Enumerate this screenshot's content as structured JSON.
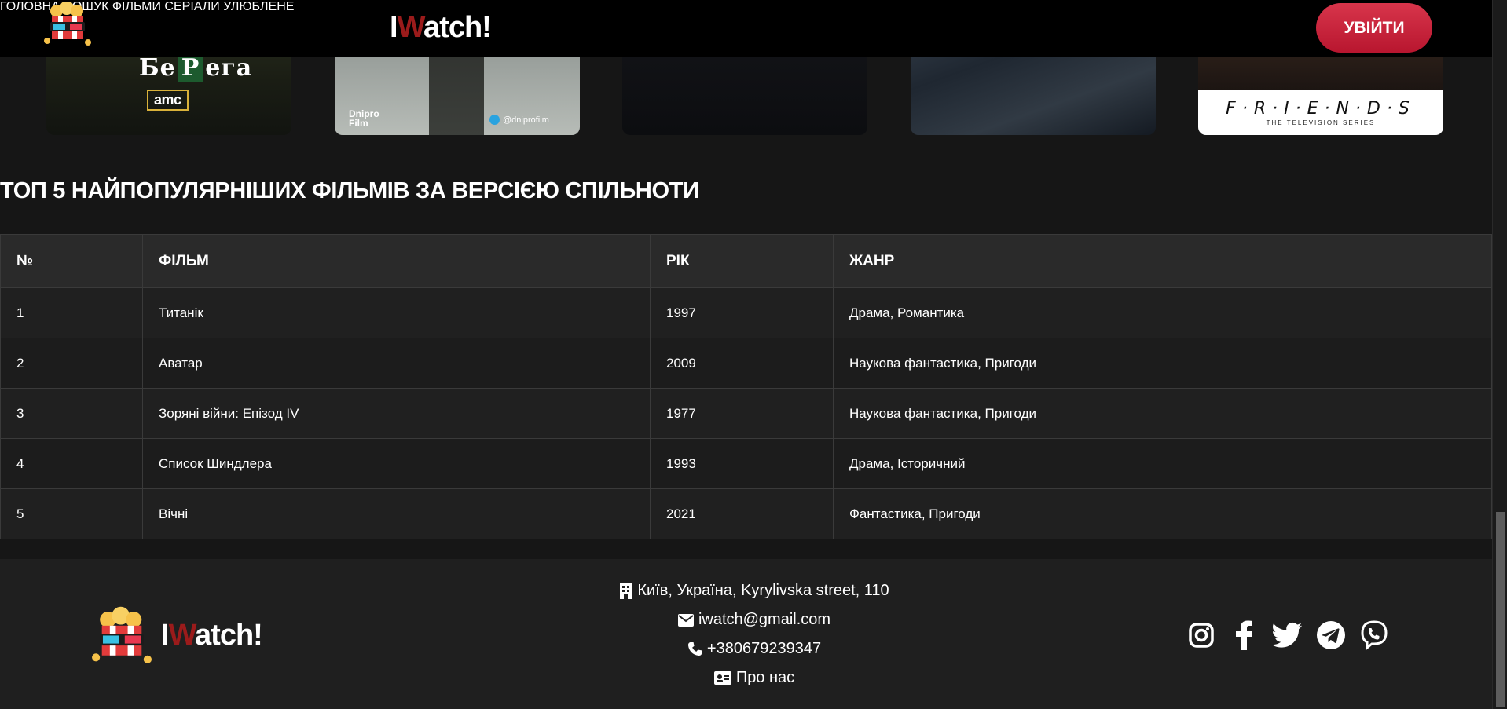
{
  "header": {
    "brand_first": "I",
    "brand_w": "W",
    "brand_rest": "atch!",
    "nav": [
      "ГОЛОВНА",
      "ПОШУК",
      "ФІЛЬМИ",
      "СЕРІАЛИ",
      "УЛЮБЛЕНЕ"
    ],
    "login_label": "УВІЙТИ"
  },
  "posters": {
    "p1_title_a": "Бе",
    "p1_title_cell": "Р",
    "p1_title_b": "ега",
    "p1_badge": "amc",
    "p2_studio": "Dnipro Film",
    "p2_tg": "@dniprofilm",
    "p5_title": "F·R·I·E·N·D·S",
    "p5_subtitle": "THE TELEVISION SERIES"
  },
  "section": {
    "title": "ТОП 5 НАЙПОПУЛЯРНІШИХ ФІЛЬМІВ ЗА ВЕРСІЄЮ СПІЛЬНОТИ"
  },
  "table": {
    "headers": [
      "№",
      "ФІЛЬМ",
      "РІК",
      "ЖАНР"
    ],
    "rows": [
      [
        "1",
        "Титанік",
        "1997",
        "Драма, Романтика"
      ],
      [
        "2",
        "Аватар",
        "2009",
        "Наукова фантастика, Пригоди"
      ],
      [
        "3",
        "Зоряні війни: Епізод IV",
        "1977",
        "Наукова фантастика, Пригоди"
      ],
      [
        "4",
        "Список Шиндлера",
        "1993",
        "Драма, Історичний"
      ],
      [
        "5",
        "Вічні",
        "2021",
        "Фантастика, Пригоди"
      ]
    ]
  },
  "footer": {
    "brand_first": "I",
    "brand_w": "W",
    "brand_rest": "atch!",
    "address": "Київ, Україна, Kyrylivska street, 110",
    "email": "iwatch@gmail.com",
    "phone": "+380679239347",
    "about": "Про нас",
    "socials": [
      "instagram-icon",
      "facebook-icon",
      "twitter-icon",
      "telegram-icon",
      "viber-icon"
    ]
  },
  "colors": {
    "accent_red": "#c41e3a",
    "brand_w": "#9b1b1b",
    "background": "#161616"
  }
}
